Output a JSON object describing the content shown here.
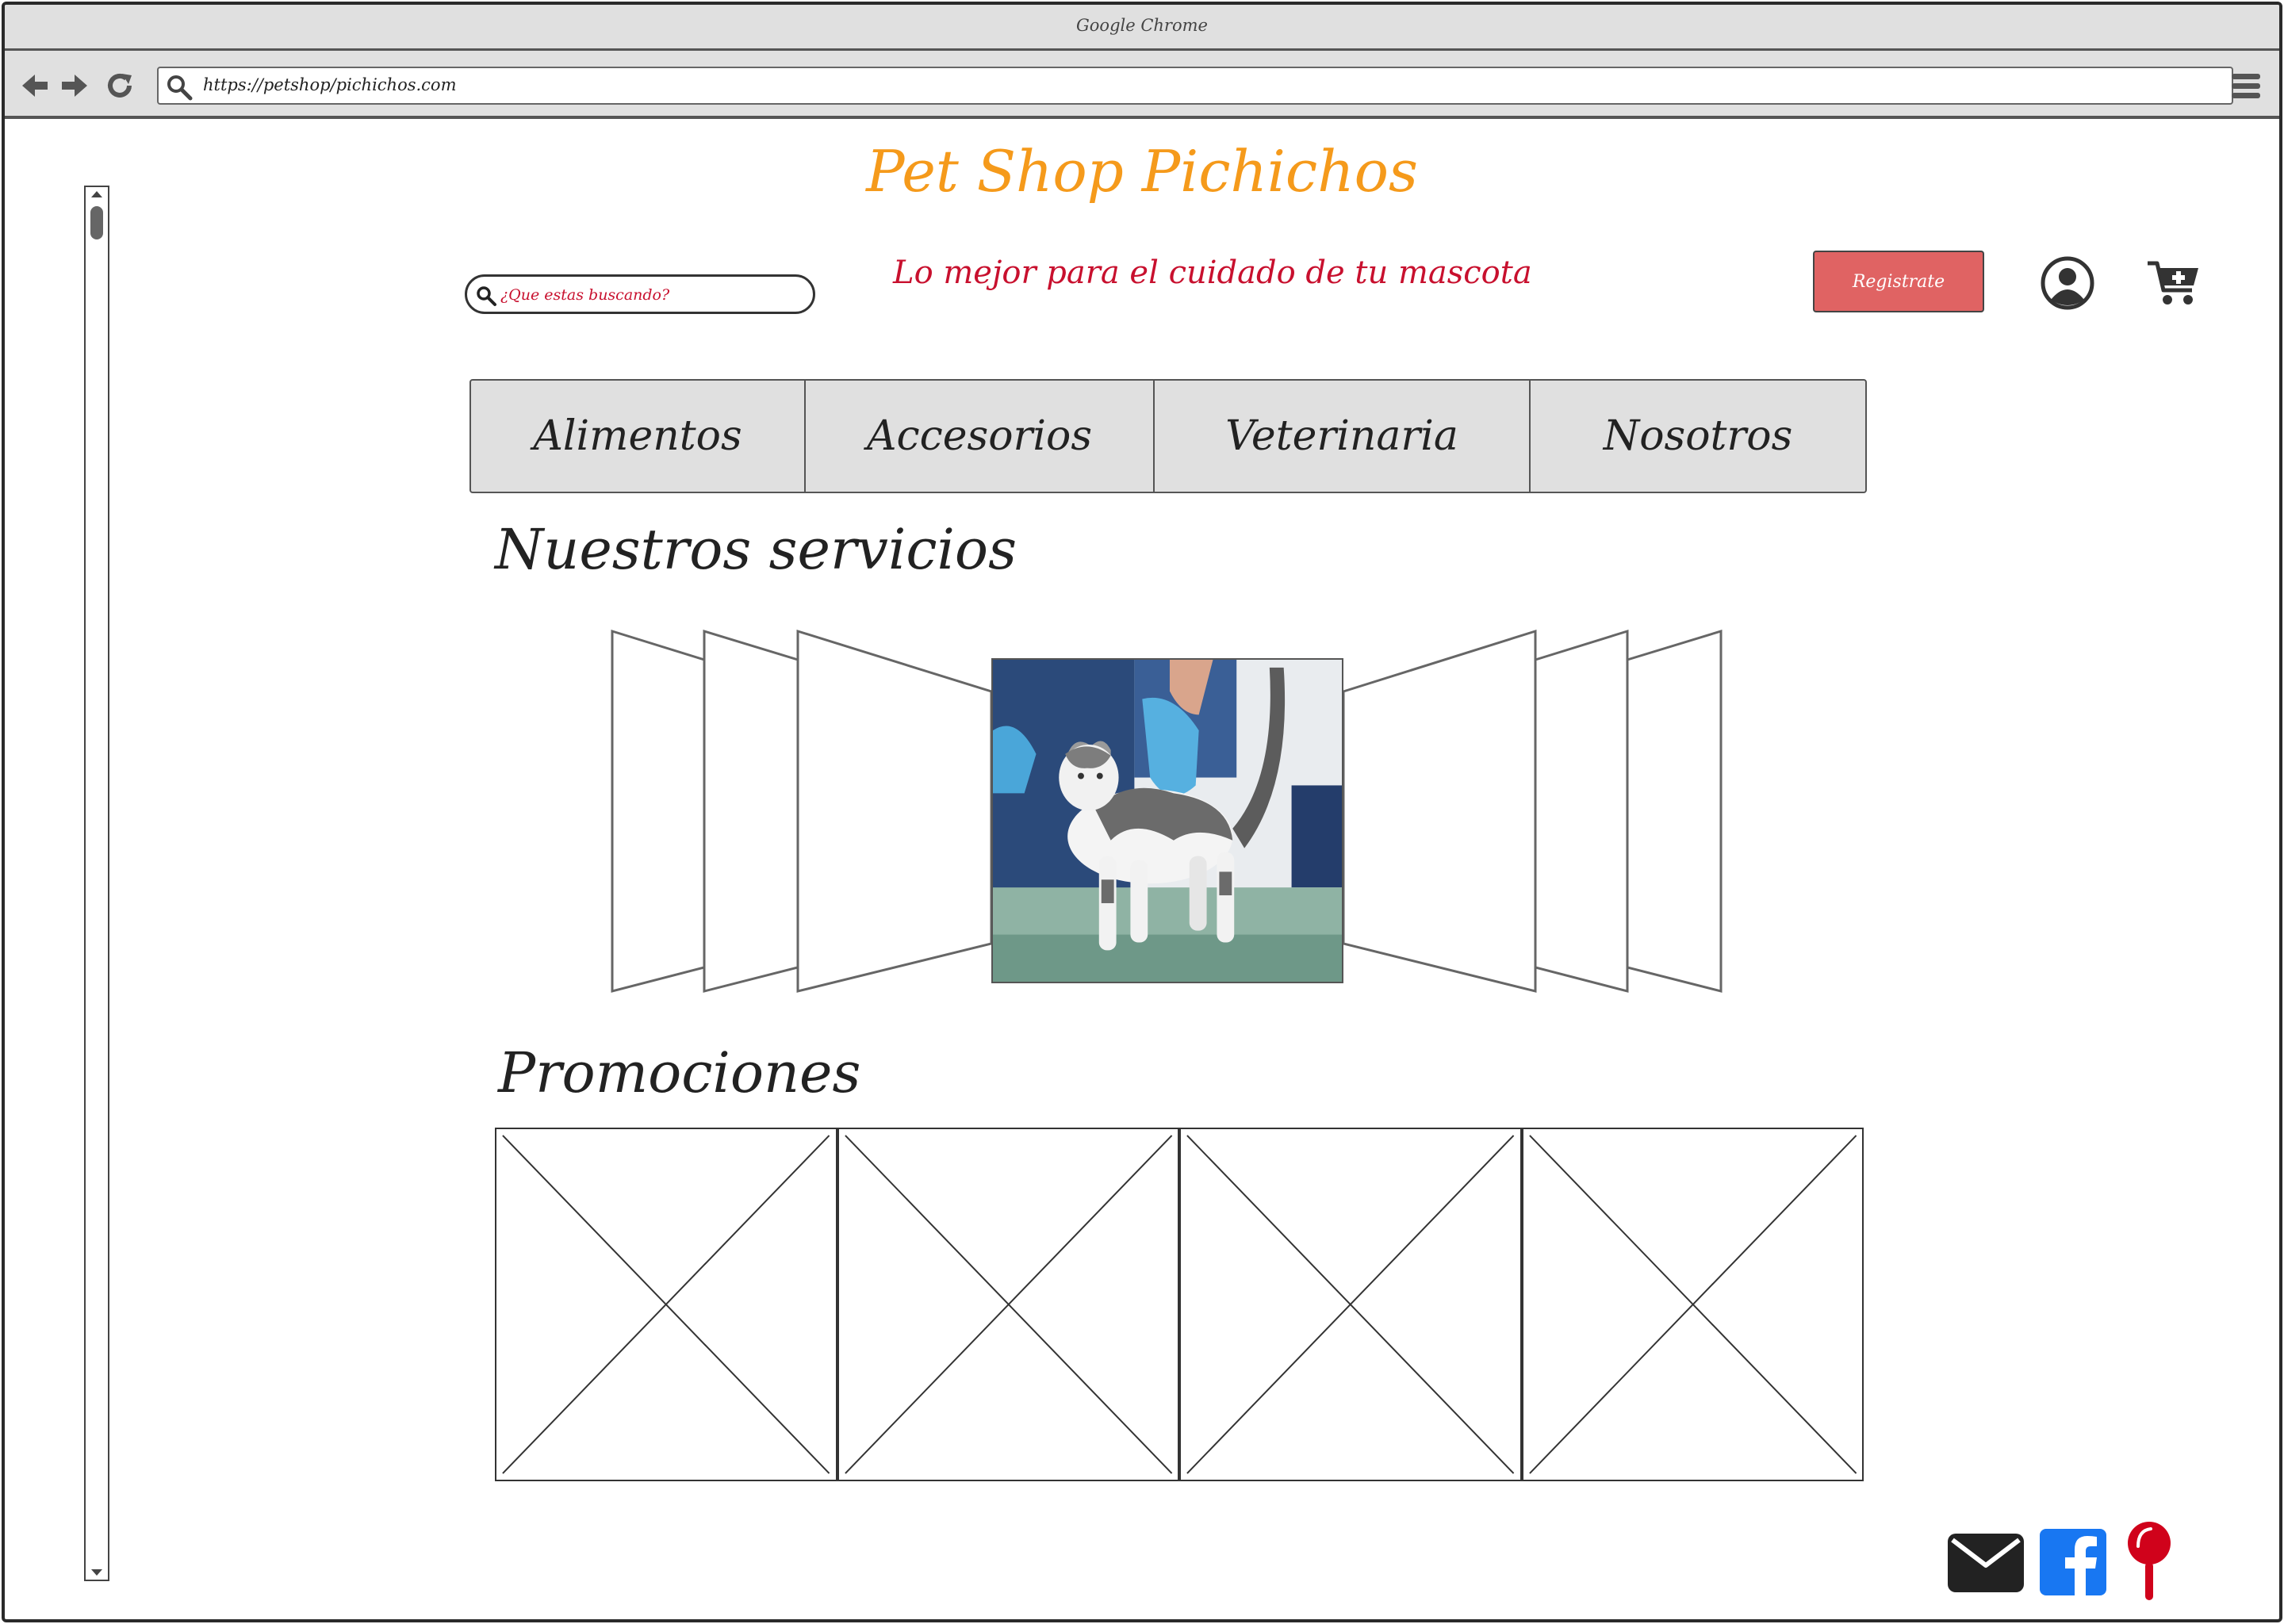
{
  "browser": {
    "window_title": "Google Chrome",
    "url": "https://petshop/pichichos.com"
  },
  "site": {
    "title": "Pet Shop Pichichos",
    "tagline": "Lo mejor para el cuidado de tu mascota",
    "title_color": "#f59a1b",
    "accent_color": "#c8102e"
  },
  "search": {
    "placeholder": "¿Que estas buscando?"
  },
  "header": {
    "register_label": "Registrate"
  },
  "nav": {
    "tabs": [
      {
        "label": "Alimentos"
      },
      {
        "label": "Accesorios"
      },
      {
        "label": "Veterinaria"
      },
      {
        "label": "Nosotros"
      }
    ]
  },
  "sections": {
    "services_heading": "Nuestros servicios",
    "promos_heading": "Promociones"
  },
  "carousel": {
    "featured_image": "cat-at-veterinarian-photo"
  },
  "promotions": {
    "items": [
      {
        "image": "placeholder-image"
      },
      {
        "image": "placeholder-image"
      },
      {
        "image": "placeholder-image"
      },
      {
        "image": "placeholder-image"
      }
    ]
  },
  "footer": {
    "social": [
      {
        "icon": "email-icon"
      },
      {
        "icon": "facebook-icon",
        "color": "#1877f2"
      },
      {
        "icon": "location-pin-icon",
        "color": "#d0021b"
      }
    ]
  }
}
